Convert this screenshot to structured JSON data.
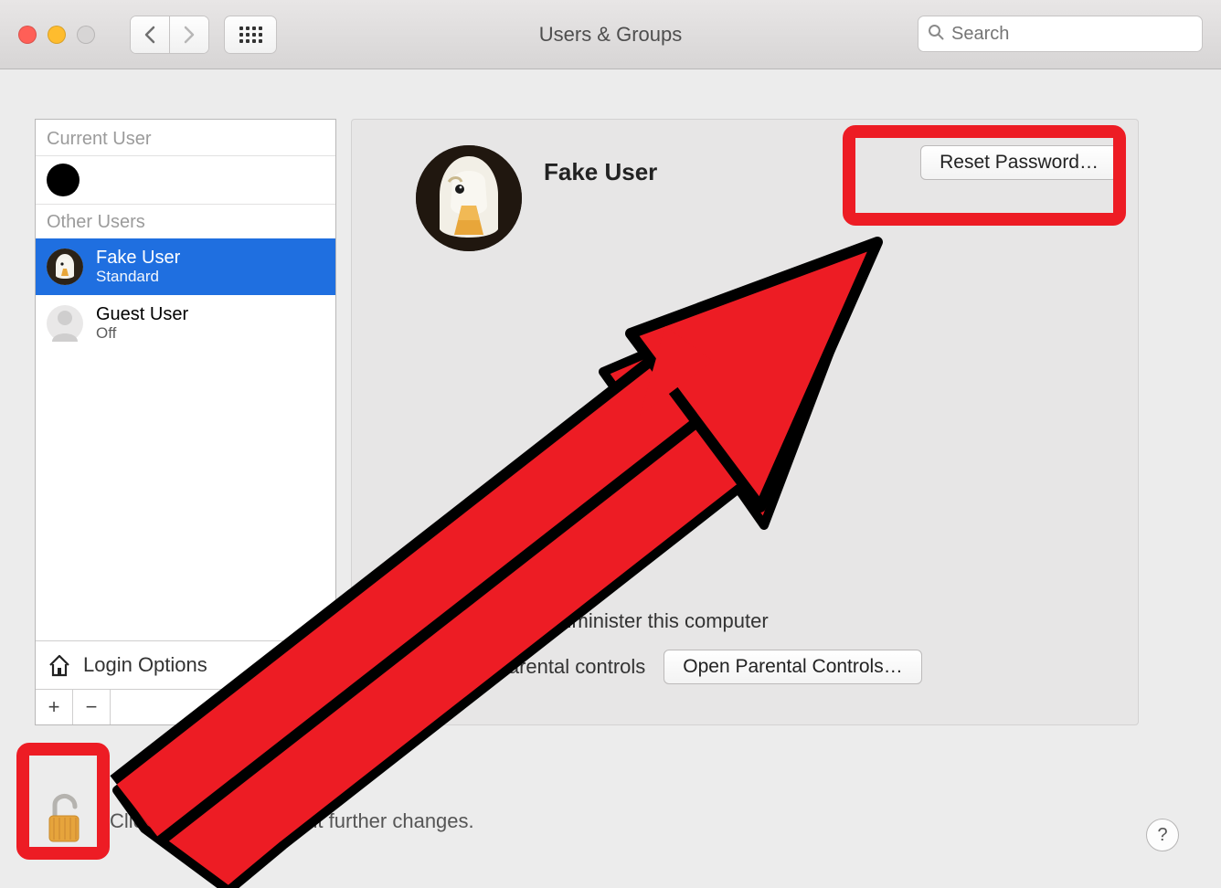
{
  "window": {
    "title": "Users & Groups"
  },
  "search": {
    "placeholder": "Search"
  },
  "sidebar": {
    "current_hdr": "Current User",
    "other_hdr": "Other Users",
    "users": [
      {
        "name": "Fake User",
        "role": "Standard"
      },
      {
        "name": "Guest User",
        "role": "Off"
      }
    ],
    "login_options": "Login Options"
  },
  "detail": {
    "name": "Fake User",
    "reset_label": "Reset Password…",
    "admin_label": "Allow user to administer this computer",
    "parental_label": "Enable parental controls",
    "open_parental_label": "Open Parental Controls…"
  },
  "footer": {
    "lock_text": "Click the lock to prevent further changes."
  }
}
